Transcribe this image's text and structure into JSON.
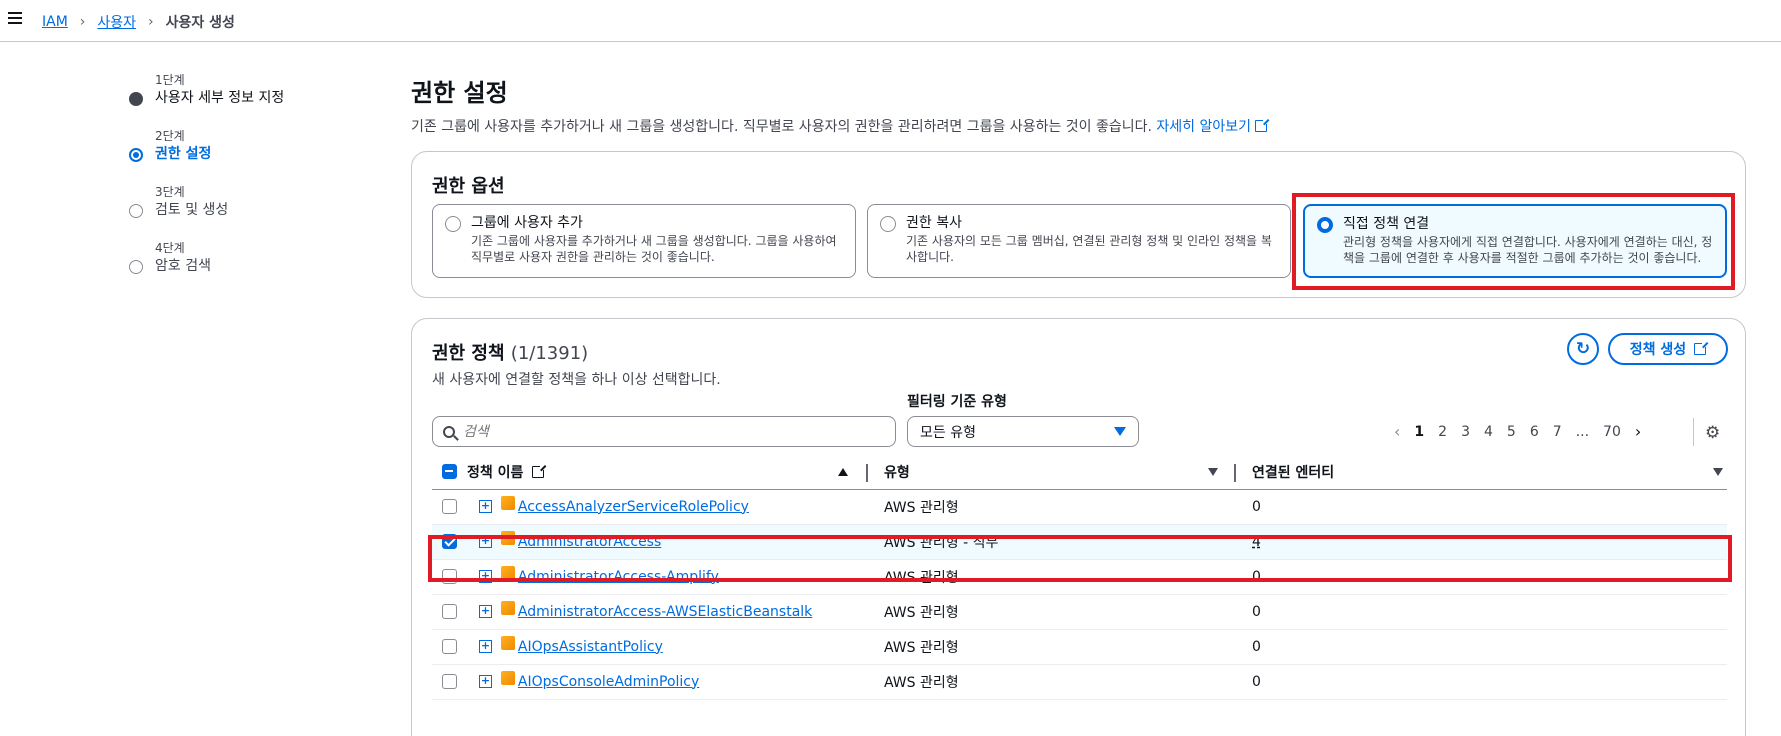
{
  "breadcrumb": {
    "items": [
      "IAM",
      "사용자"
    ],
    "current": "사용자 생성"
  },
  "steps": [
    {
      "num": "1단계",
      "title": "사용자 세부 정보 지정"
    },
    {
      "num": "2단계",
      "title": "권한 설정"
    },
    {
      "num": "3단계",
      "title": "검토 및 생성"
    },
    {
      "num": "4단계",
      "title": "암호 검색"
    }
  ],
  "page": {
    "title": "권한 설정",
    "desc": "기존 그룹에 사용자를 추가하거나 새 그룹을 생성합니다. 직무별로 사용자의 권한을 관리하려면 그룹을 사용하는 것이 좋습니다.",
    "learn_more": "자세히 알아보기"
  },
  "options": {
    "title": "권한 옵션",
    "cards": [
      {
        "title": "그룹에 사용자 추가",
        "desc": "기존 그룹에 사용자를 추가하거나 새 그룹을 생성합니다. 그룹을 사용하여 직무별로 사용자 권한을 관리하는 것이 좋습니다."
      },
      {
        "title": "권한 복사",
        "desc": "기존 사용자의 모든 그룹 멤버십, 연결된 관리형 정책 및 인라인 정책을 복사합니다."
      },
      {
        "title": "직접 정책 연결",
        "desc": "관리형 정책을 사용자에게 직접 연결합니다. 사용자에게 연결하는 대신, 정책을 그룹에 연결한 후 사용자를 적절한 그룹에 추가하는 것이 좋습니다."
      }
    ]
  },
  "policies": {
    "title": "권한 정책",
    "count": "(1/1391)",
    "desc": "새 사용자에 연결할 정책을 하나 이상 선택합니다.",
    "create_label": "정책 생성",
    "filter_label": "필터링 기준 유형",
    "search_placeholder": "검색",
    "filter_value": "모든 유형",
    "pages": [
      "1",
      "2",
      "3",
      "4",
      "5",
      "6",
      "7",
      "...",
      "70"
    ],
    "columns": {
      "name": "정책 이름",
      "type": "유형",
      "entities": "연결된 엔터티"
    },
    "rows": [
      {
        "name": "AccessAnalyzerServiceRolePolicy",
        "type": "AWS 관리형",
        "entities": "0",
        "checked": false
      },
      {
        "name": "AdministratorAccess",
        "type": "AWS 관리형 - 직무",
        "entities": "4",
        "checked": true
      },
      {
        "name": "AdministratorAccess-Amplify",
        "type": "AWS 관리형",
        "entities": "0",
        "checked": false
      },
      {
        "name": "AdministratorAccess-AWSElasticBeanstalk",
        "type": "AWS 관리형",
        "entities": "0",
        "checked": false
      },
      {
        "name": "AIOpsAssistantPolicy",
        "type": "AWS 관리형",
        "entities": "0",
        "checked": false
      },
      {
        "name": "AIOpsConsoleAdminPolicy",
        "type": "AWS 관리형",
        "entities": "0",
        "checked": false
      }
    ]
  }
}
